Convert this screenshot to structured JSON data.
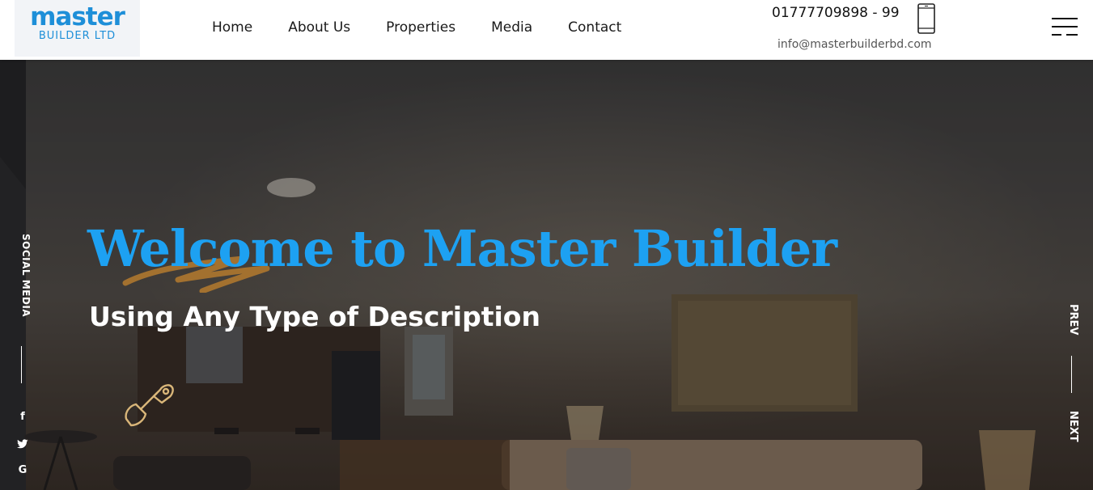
{
  "brand": {
    "logo_main": "master",
    "logo_sub": "BUILDER LTD",
    "color": "#1e8fd8"
  },
  "nav": {
    "items": [
      {
        "label": "Home"
      },
      {
        "label": "About Us"
      },
      {
        "label": "Properties"
      },
      {
        "label": "Media"
      },
      {
        "label": "Contact"
      }
    ]
  },
  "contact": {
    "phone": "01777709898 - 99",
    "email": "info@masterbuilderbd.com",
    "phone_icon": "mobile-phone-icon"
  },
  "menu_toggle": {
    "icon": "hamburger-menu-icon"
  },
  "hero": {
    "title": "Welcome to Master Builder",
    "subtitle": "Using Any Type of Description",
    "title_color": "#1da1f2",
    "accent_color": "#a9742e",
    "decor_icon": "shovel-icon"
  },
  "social": {
    "label": "SOCIAL MEDIA",
    "links": [
      {
        "glyph": "f",
        "icon": "facebook-icon"
      },
      {
        "glyph": "🐦",
        "icon": "twitter-icon"
      },
      {
        "glyph": "G",
        "icon": "google-icon"
      }
    ]
  },
  "slider": {
    "prev_label": "PREV",
    "next_label": "NEXT"
  }
}
